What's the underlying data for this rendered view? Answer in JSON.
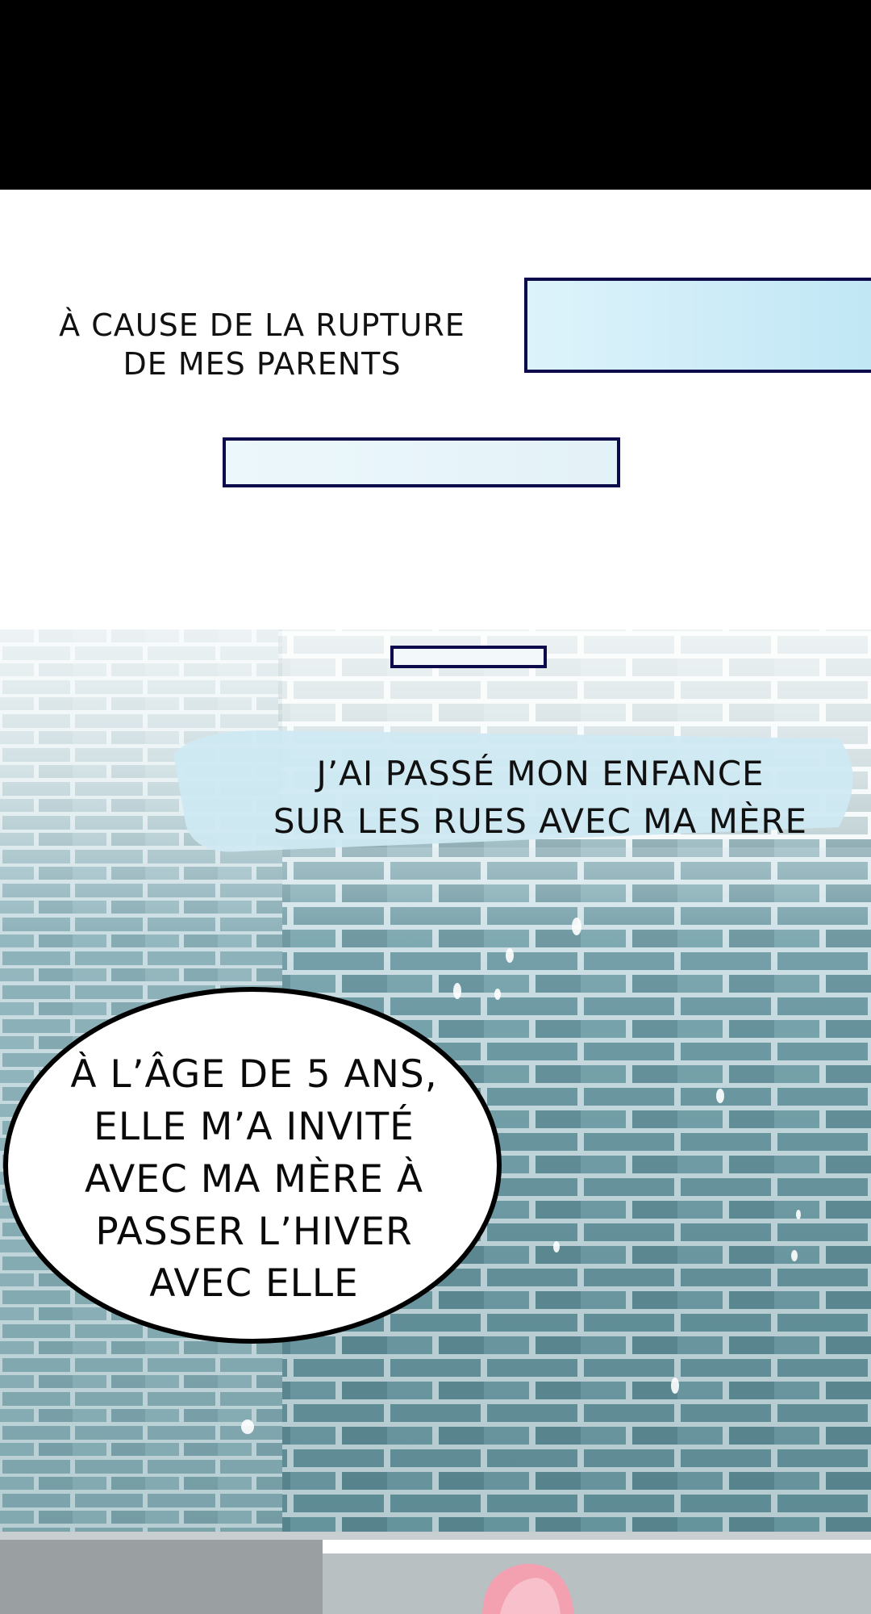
{
  "captions": {
    "rupture": {
      "lines": [
        "À CAUSE DE LA RUPTURE",
        "DE MES PARENTS"
      ]
    },
    "enfance": {
      "lines": [
        "J’AI PASSÉ MON ENFANCE",
        "SUR LES RUES AVEC MA MÈRE"
      ]
    }
  },
  "speech_bubble": {
    "lines": [
      "À L’ÂGE DE 5 ANS,",
      "ELLE M’A INVITÉ",
      "AVEC MA MÈRE À",
      "PASSER L’HIVER",
      "AVEC ELLE"
    ]
  },
  "colors": {
    "letterbox": "#000000",
    "box_border": "#0c0a4a",
    "brick_wall": "#5f8d96",
    "bubble_border": "#000000",
    "hair_pink": "#f3a1b0"
  }
}
